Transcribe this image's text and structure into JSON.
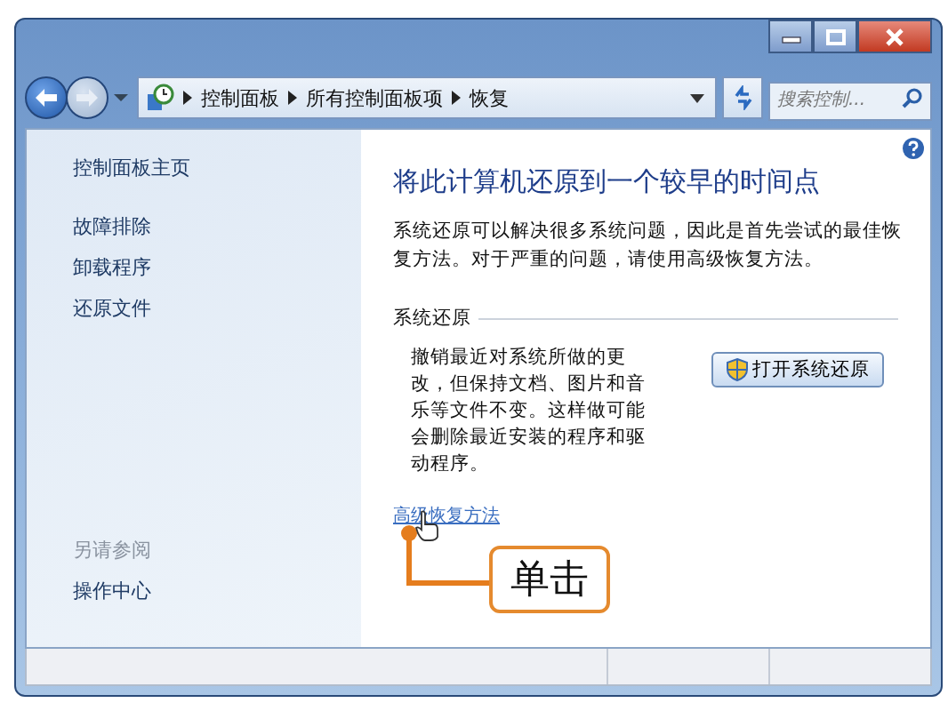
{
  "address_bar": {
    "breadcrumbs": [
      "控制面板",
      "所有控制面板项",
      "恢复"
    ]
  },
  "search": {
    "placeholder": "搜索控制..."
  },
  "sidebar": {
    "links": [
      "控制面板主页",
      "故障排除",
      "卸载程序",
      "还原文件"
    ],
    "see_also": {
      "heading": "另请参阅",
      "links": [
        "操作中心"
      ]
    }
  },
  "main": {
    "title": "将此计算机还原到一个较早的时间点",
    "description": "系统还原可以解决很多系统问题，因此是首先尝试的最佳恢复方法。对于严重的问题，请使用高级恢复方法。",
    "section": {
      "heading": "系统还原",
      "text": "撤销最近对系统所做的更改，但保持文档、图片和音乐等文件不变。这样做可能会删除最近安装的程序和驱动程序。",
      "button": "打开系统还原"
    },
    "link": "高级恢复方法"
  },
  "annotation": {
    "label": "单击"
  }
}
